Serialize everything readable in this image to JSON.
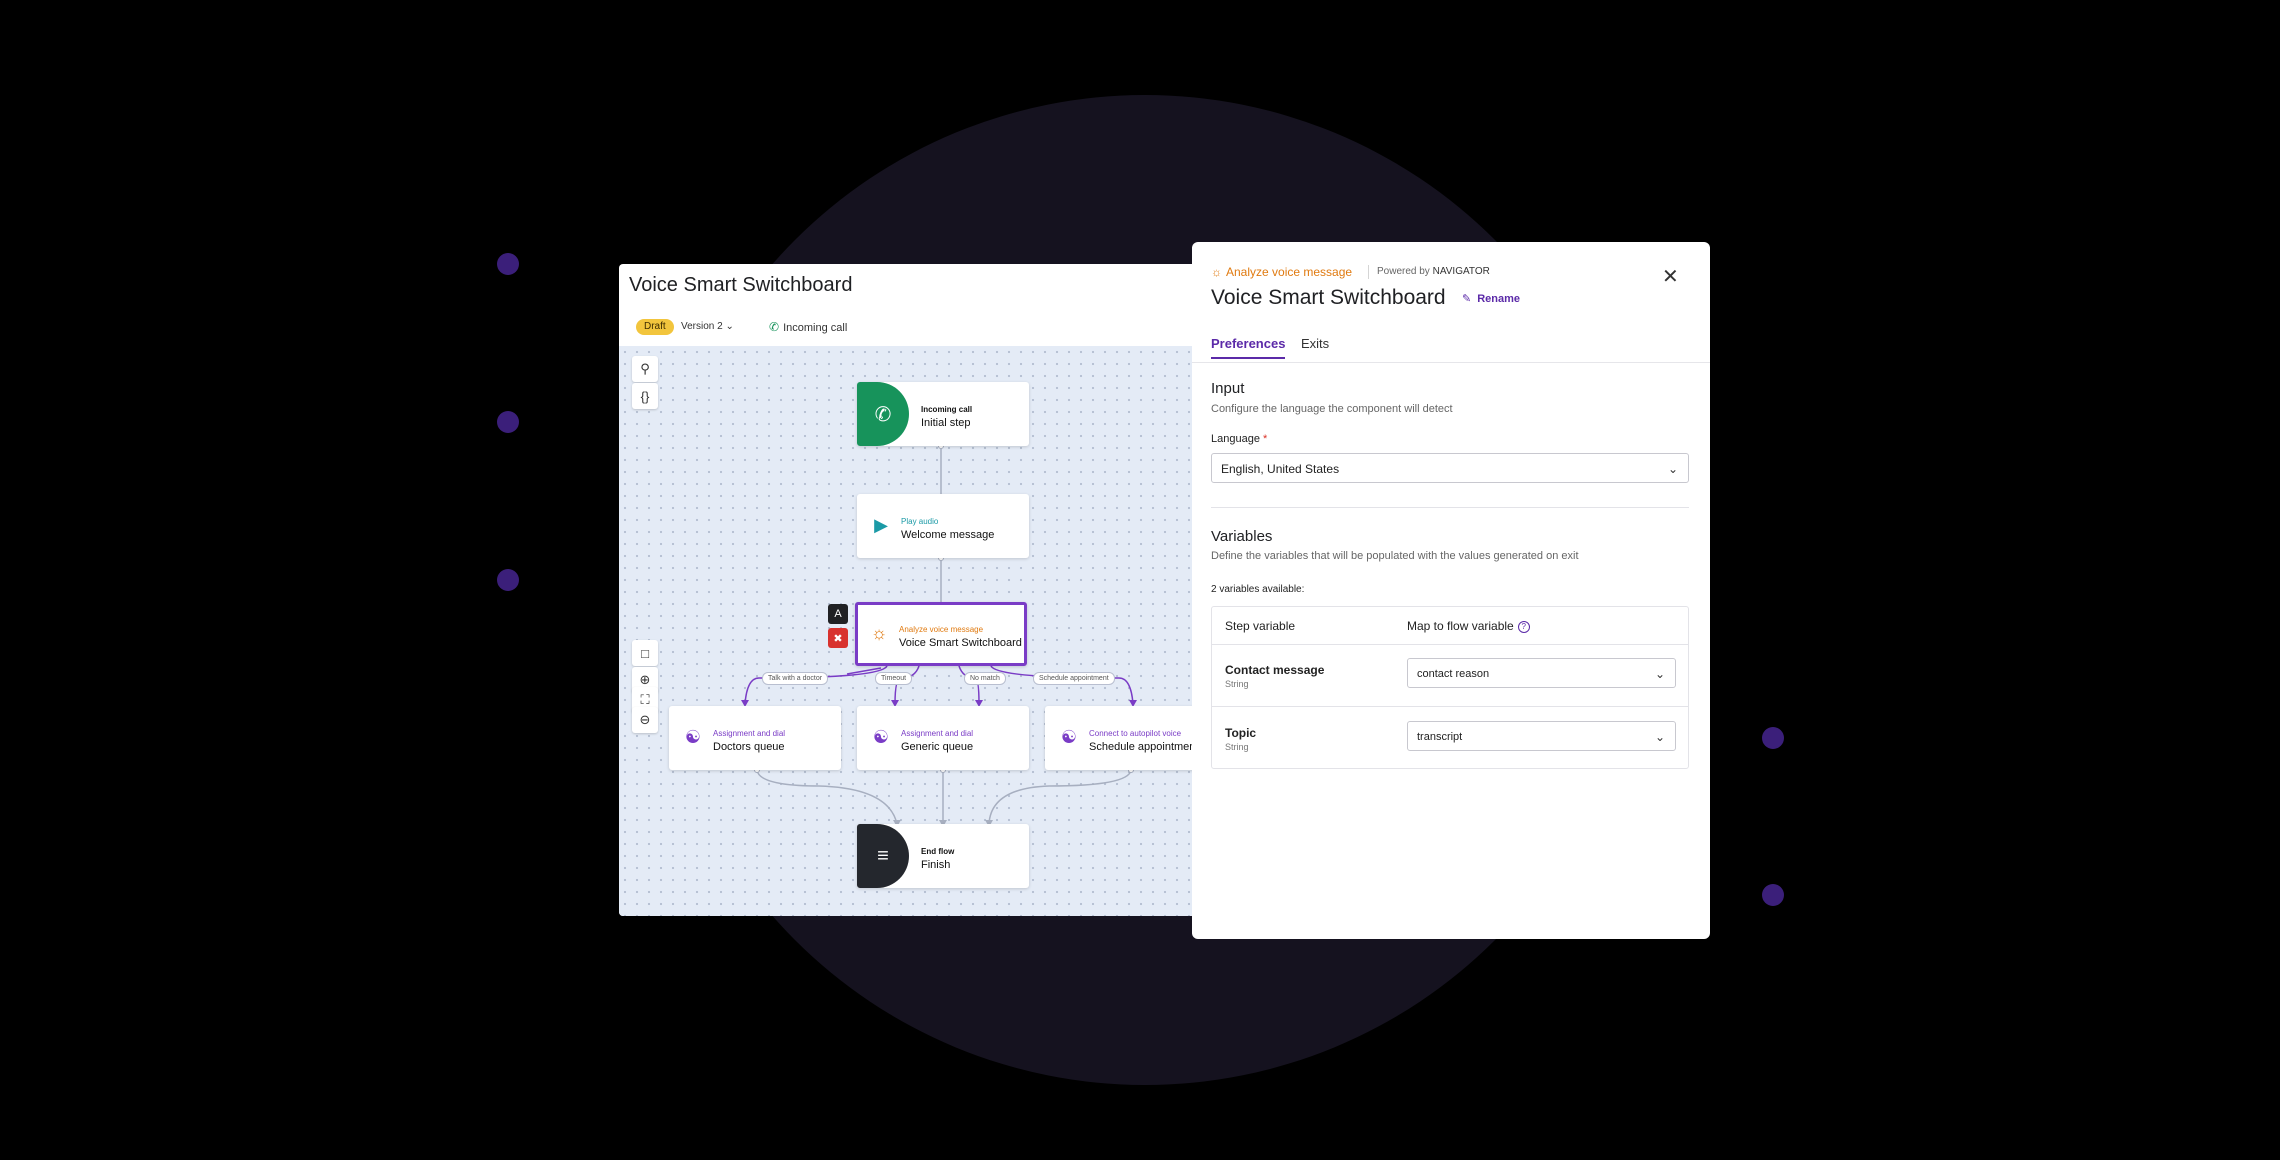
{
  "builder": {
    "title": "Voice Smart Switchboard",
    "status_badge": "Draft",
    "version_label": "Version 2",
    "trigger_tab": "Incoming call",
    "nodes": {
      "start": {
        "kind": "Incoming call",
        "name": "Initial step"
      },
      "play": {
        "kind": "Play audio",
        "name": "Welcome message"
      },
      "analyze": {
        "kind": "Analyze voice message",
        "name": "Voice Smart Switchboard"
      },
      "doctors": {
        "kind": "Assignment and dial",
        "name": "Doctors queue"
      },
      "generic": {
        "kind": "Assignment and dial",
        "name": "Generic queue"
      },
      "autopilot": {
        "kind": "Connect to autopilot voice",
        "name": "Schedule appointment"
      },
      "end": {
        "kind": "End flow",
        "name": "Finish"
      }
    },
    "exit_labels": [
      "Talk with a doctor",
      "Timeout",
      "No match",
      "Schedule appointment"
    ],
    "side_buttons": {
      "rename_glyph": "A"
    }
  },
  "panel": {
    "component_kind": "Analyze voice message",
    "powered_by_prefix": "Powered by",
    "powered_by_name": "NAVIGATOR",
    "title": "Voice Smart Switchboard",
    "rename_label": "Rename",
    "tabs": [
      "Preferences",
      "Exits"
    ],
    "active_tab": "Preferences",
    "input": {
      "heading": "Input",
      "description": "Configure the language the component will detect",
      "language_label": "Language",
      "language_value": "English, United States"
    },
    "variables": {
      "heading": "Variables",
      "description": "Define the variables that will be populated with the values generated on exit",
      "count_text": "2 variables available:",
      "col_step": "Step variable",
      "col_map": "Map to flow variable",
      "rows": [
        {
          "name": "Contact message",
          "type": "String",
          "mapped": "contact reason"
        },
        {
          "name": "Topic",
          "type": "String",
          "mapped": "transcript"
        }
      ]
    }
  },
  "colors": {
    "accent_purple": "#5b2aa8",
    "analyze_orange": "#e07a10",
    "incoming_green": "#17935b",
    "draft_yellow": "#f2c53d"
  },
  "icons": [
    "search-icon",
    "braces-icon",
    "comment-icon",
    "zoom-in-icon",
    "fit-screen-icon",
    "zoom-out-icon",
    "phone-icon",
    "play-icon",
    "analyze-icon",
    "agent-icon",
    "end-flow-icon",
    "delete-icon",
    "close-icon",
    "pencil-icon",
    "chevron-down-icon",
    "help-icon"
  ]
}
